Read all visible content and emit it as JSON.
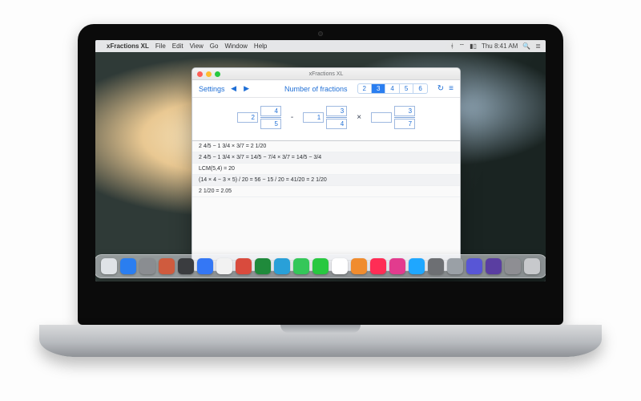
{
  "menubar": {
    "apple": "",
    "app_name": "xFractions XL",
    "items": [
      "File",
      "Edit",
      "View",
      "Go",
      "Window",
      "Help"
    ],
    "status": {
      "clock": "Thu 8:41 AM",
      "search_icon": "search-icon"
    }
  },
  "window": {
    "title": "xFractions XL",
    "toolbar": {
      "settings_label": "Settings",
      "nof_label": "Number of fractions",
      "nof_options": [
        "2",
        "3",
        "4",
        "5",
        "6"
      ],
      "nof_selected_index": 1,
      "refresh_icon": "↻",
      "menu_icon": "≡"
    },
    "expression": {
      "terms": [
        {
          "whole": "2",
          "num": "4",
          "den": "5"
        },
        {
          "whole": "1",
          "num": "3",
          "den": "4"
        },
        {
          "whole": "",
          "num": "3",
          "den": "7"
        }
      ],
      "operators": [
        "-",
        "×"
      ]
    },
    "work_steps": [
      "2 4/5 − 1 3/4 × 3/7 = 2 1/20",
      "2 4/5 − 1 3/4 × 3/7 = 14/5 − 7/4 × 3/7 = 14/5 − 3/4",
      "LCM(5,4) = 20",
      "(14 × 4 − 3 × 5) / 20 = 56 − 15 / 20 = 41/20 = 2 1/20",
      "2 1/20 = 2.05"
    ],
    "status_chevron": "▲"
  },
  "dock_colors": [
    "#dfe3e7",
    "#2a7ef0",
    "#8a8d91",
    "#cf5b3e",
    "#3a3c3f",
    "#3477f5",
    "#f2f2f2",
    "#d94b3d",
    "#1f8a3b",
    "#29a0d8",
    "#34c759",
    "#28c840",
    "#ffffff",
    "#f08c2e",
    "#ff2d55",
    "#e23b8e",
    "#1fa7ff",
    "#6d6f73",
    "#9aa0a6",
    "#5856d6",
    "#5a3ea1",
    "#8e8e93",
    "#c7c9cc"
  ]
}
